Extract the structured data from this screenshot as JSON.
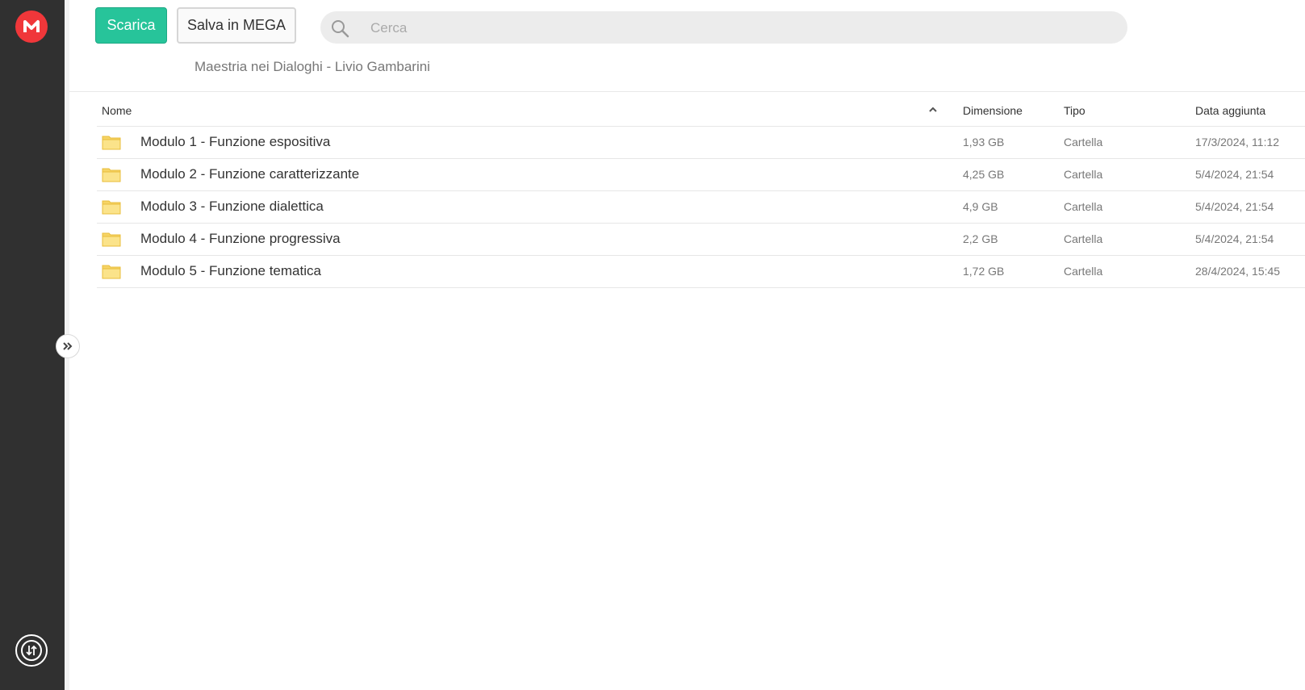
{
  "sidebar": {
    "logo_icon": "mega-logo-icon",
    "logo_color": "#f0373a",
    "transfer_icon": "transfer-icon"
  },
  "toolbar": {
    "download_label": "Scarica",
    "save_label": "Salva in MEGA"
  },
  "search": {
    "placeholder": "Cerca",
    "value": ""
  },
  "breadcrumb": "Maestria nei Dialoghi - Livio Gambarini",
  "table": {
    "columns": {
      "name": "Nome",
      "size": "Dimensione",
      "type": "Tipo",
      "date": "Data aggiunta"
    },
    "rows": [
      {
        "name": "Modulo 1 - Funzione espositiva",
        "size": "1,93 GB",
        "type": "Cartella",
        "date": "17/3/2024, 11:12"
      },
      {
        "name": "Modulo 2 - Funzione caratterizzante",
        "size": "4,25 GB",
        "type": "Cartella",
        "date": "5/4/2024, 21:54"
      },
      {
        "name": "Modulo 3 - Funzione dialettica",
        "size": "4,9 GB",
        "type": "Cartella",
        "date": "5/4/2024, 21:54"
      },
      {
        "name": "Modulo 4 - Funzione progressiva",
        "size": "2,2 GB",
        "type": "Cartella",
        "date": "5/4/2024, 21:54"
      },
      {
        "name": "Modulo 5 - Funzione tematica",
        "size": "1,72 GB",
        "type": "Cartella",
        "date": "28/4/2024, 15:45"
      }
    ]
  },
  "colors": {
    "accent": "#27c49a",
    "sidebar": "#303030",
    "folder": "#f6d465"
  }
}
